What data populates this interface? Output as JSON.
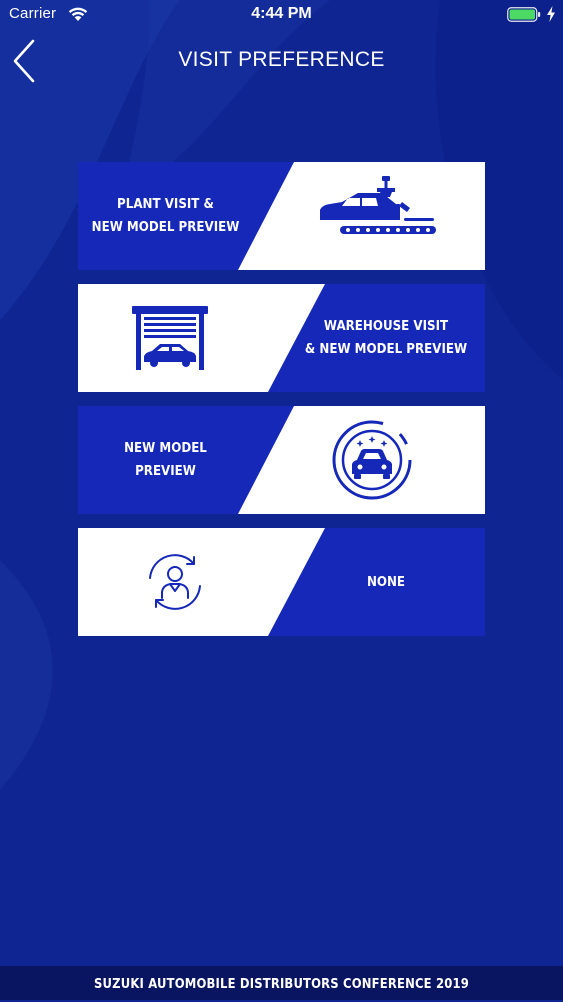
{
  "status_bar": {
    "carrier": "Carrier",
    "time": "4:44 PM",
    "icons": [
      "wifi-icon",
      "battery-icon",
      "charging-bolt-icon"
    ],
    "battery_color": "#4cd964"
  },
  "header": {
    "back_icon": "chevron-left-icon",
    "title": "VISIT PREFERENCE"
  },
  "options": [
    {
      "label": "PLANT VISIT &\nNEW MODEL PREVIEW",
      "icon": "car-assembly-line-icon"
    },
    {
      "label": "WAREHOUSE VISIT\n& NEW MODEL PREVIEW",
      "icon": "garage-car-icon"
    },
    {
      "label": "NEW MODEL\nPREVIEW",
      "icon": "new-car-badge-icon"
    },
    {
      "label": "NONE",
      "icon": "person-cycle-icon"
    }
  ],
  "footer": {
    "text": "SUZUKI AUTOMOBILE DISTRIBUTORS CONFERENCE 2019"
  },
  "colors": {
    "background": "#0e2592",
    "accent_blue": "#1628b8",
    "card_white": "#ffffff",
    "footer": "#0a1561"
  }
}
